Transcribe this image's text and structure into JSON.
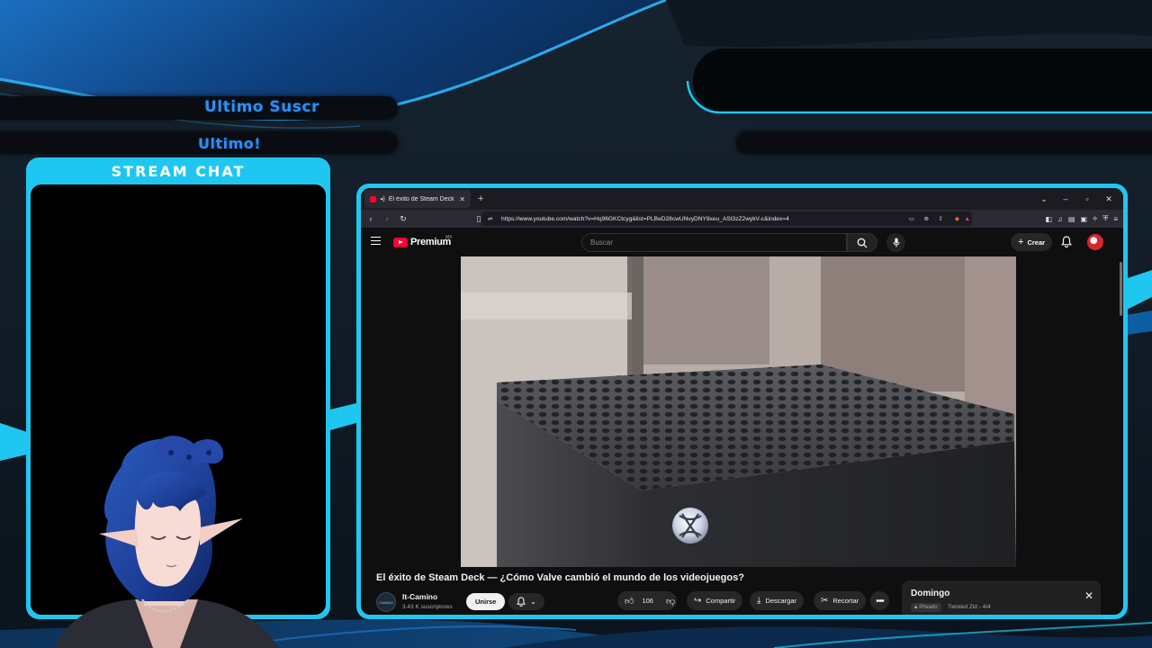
{
  "overlay": {
    "last_sub_label": "Ultimo Suscr",
    "last_label": "Ultimo!",
    "chat_title": "STREAM CHAT",
    "accent_color": "#1fc7f0",
    "label_color": "#2f8ff0"
  },
  "browser": {
    "tab_title": "El éxito de Steam Deck — ¿Có",
    "url": "https://www.youtube.com/watch?v=Hq96GKCtcyg&list=PLBeD28cwUNvyDNY8xeu_ASt3zZ2wykV-c&index=4",
    "icons": [
      "back-icon",
      "forward-icon",
      "reload-icon",
      "bookmark-icon",
      "tune-icon",
      "screenshot-icon",
      "zoom-icon",
      "share-icon",
      "brave-icon",
      "alert-icon",
      "sidebar-icon",
      "music-icon",
      "reader-icon",
      "tab-icon",
      "wallet-icon",
      "shield-icon",
      "menu-icon"
    ]
  },
  "youtube": {
    "brand": "Premium",
    "region": "MX",
    "search_placeholder": "Buscar",
    "create_label": "Crear",
    "video_title": "El éxito de Steam Deck — ¿Cómo Valve cambió el mundo de los videojuegos?",
    "channel_name": "It-Camino",
    "channel_avatar_text": "CAMINO",
    "subscribers": "3.43 K suscriptores",
    "join_label": "Unirse",
    "likes": "106",
    "share_label": "Compartir",
    "download_label": "Descargar",
    "clip_label": "Recortar",
    "playlist": {
      "title": "Domingo",
      "privacy": "Privado",
      "meta": "Twisted Zid - 4/4"
    }
  }
}
